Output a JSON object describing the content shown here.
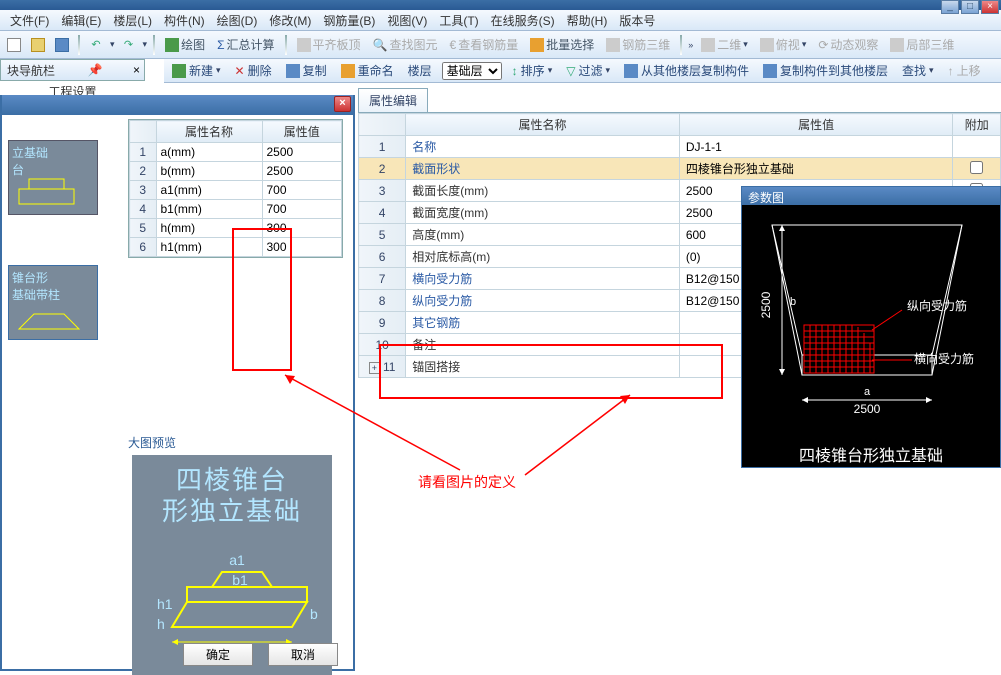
{
  "menu": {
    "items": [
      "文件(F)",
      "编辑(E)",
      "楼层(L)",
      "构件(N)",
      "绘图(D)",
      "修改(M)",
      "钢筋量(B)",
      "视图(V)",
      "工具(T)",
      "在线服务(S)",
      "帮助(H)",
      "版本号"
    ]
  },
  "toolbar1": {
    "draw": "绘图",
    "sum": "汇总计算",
    "level_top": "平齐板顶",
    "find_elem": "查找图元",
    "view_rebar": "查看钢筋量",
    "batch_select": "批量选择",
    "rebar_3d": "钢筋三维",
    "two_d": "二维",
    "bird_view": "俯视",
    "dynamic_obs": "动态观察",
    "local_3d": "局部三维"
  },
  "toolbar2": {
    "new": "新建",
    "delete": "删除",
    "copy": "复制",
    "rename": "重命名",
    "floor": "楼层",
    "floor_sel": "基础层",
    "sort": "排序",
    "filter": "过滤",
    "copy_from": "从其他楼层复制构件",
    "copy_to": "复制构件到其他楼层",
    "find": "查找",
    "up": "上移"
  },
  "nav": {
    "title": "块导航栏",
    "proj_settings": "工程设置"
  },
  "dialog": {
    "thumbs": [
      {
        "label": "立基础\n台"
      },
      {
        "label": "锥台形\n基础带柱"
      }
    ],
    "table": {
      "col_name": "属性名称",
      "col_value": "属性值",
      "rows": [
        {
          "name": "a(mm)",
          "value": "2500"
        },
        {
          "name": "b(mm)",
          "value": "2500"
        },
        {
          "name": "a1(mm)",
          "value": "700"
        },
        {
          "name": "b1(mm)",
          "value": "700"
        },
        {
          "name": "h(mm)",
          "value": "300"
        },
        {
          "name": "h1(mm)",
          "value": "300"
        }
      ]
    },
    "preview_label": "大图预览",
    "preview_title1": "四棱锥台",
    "preview_title2": "形独立基础",
    "ok": "确定",
    "cancel": "取消"
  },
  "prop_panel": {
    "tab": "属性编辑",
    "col_name": "属性名称",
    "col_value": "属性值",
    "col_extra": "附加",
    "rows": [
      {
        "num": "1",
        "name": "名称",
        "value": "DJ-1-1",
        "link": true,
        "chk": false
      },
      {
        "num": "2",
        "name": "截面形状",
        "value": "四棱锥台形独立基础",
        "link": true,
        "sel": true,
        "chk": true
      },
      {
        "num": "3",
        "name": "截面长度(mm)",
        "value": "2500",
        "link": false,
        "chk": true
      },
      {
        "num": "4",
        "name": "截面宽度(mm)",
        "value": "2500",
        "link": false,
        "chk": true
      },
      {
        "num": "5",
        "name": "高度(mm)",
        "value": "600",
        "link": false,
        "chk": true
      },
      {
        "num": "6",
        "name": "相对底标高(m)",
        "value": "(0)",
        "link": false,
        "chk": true
      },
      {
        "num": "7",
        "name": "横向受力筋",
        "value": "B12@150",
        "link": true,
        "chk": true
      },
      {
        "num": "8",
        "name": "纵向受力筋",
        "value": "B12@150",
        "link": true,
        "chk": true
      },
      {
        "num": "9",
        "name": "其它钢筋",
        "value": "",
        "link": true,
        "chk": true
      },
      {
        "num": "10",
        "name": "备注",
        "value": "",
        "link": false,
        "chk": true
      },
      {
        "num": "11",
        "name": "锚固搭接",
        "value": "",
        "link": false,
        "expand": true
      }
    ]
  },
  "param_window": {
    "title": "参数图",
    "label_v": "纵向受力筋",
    "label_h": "横向受力筋",
    "dim_a": "2500",
    "dim_b": "2500",
    "axis_a": "a",
    "axis_b": "b",
    "big_label": "四棱锥台形独立基础"
  },
  "annotation_text": "请看图片的定义"
}
